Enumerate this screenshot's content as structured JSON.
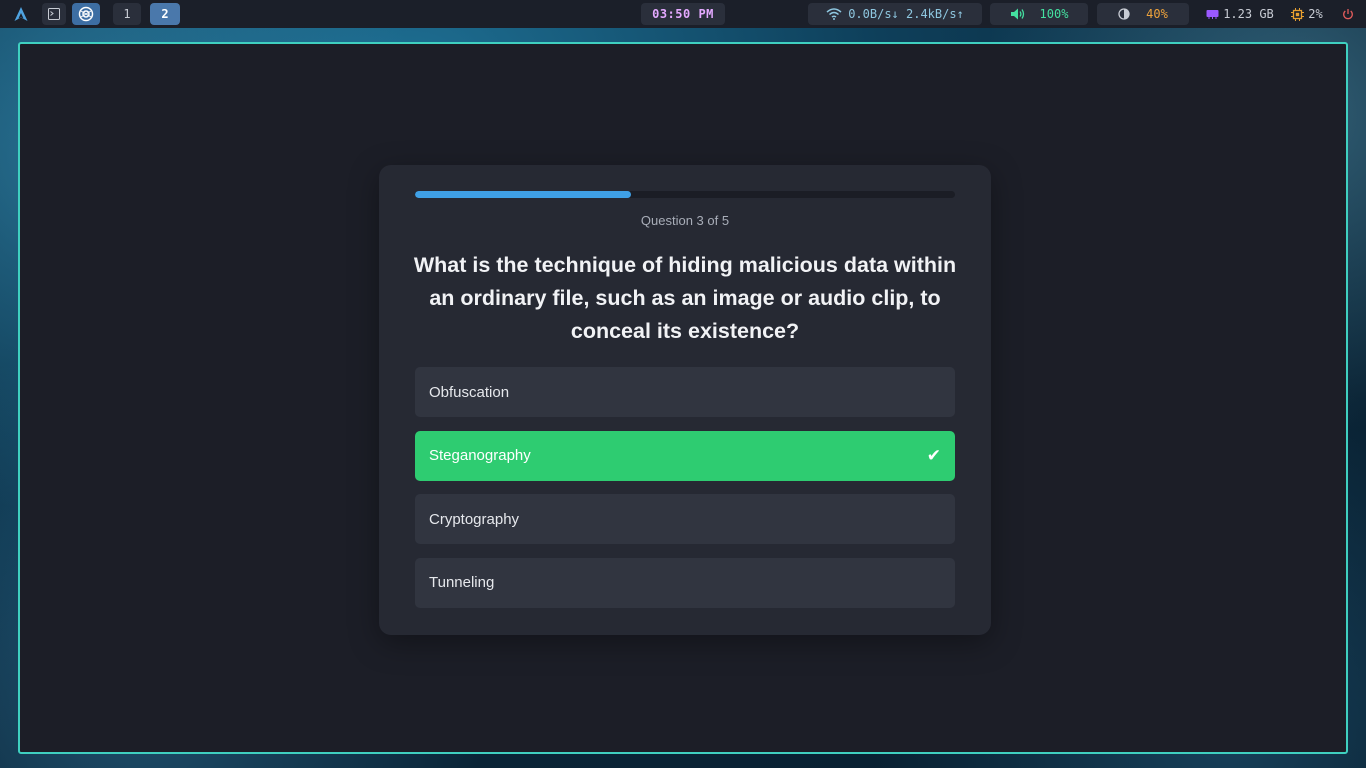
{
  "topbar": {
    "launcher_icon": "arch-linux-icon",
    "terminal_icon": "terminal-icon",
    "app_icon": "browser-app-icon",
    "workspaces": [
      "1",
      "2"
    ],
    "active_workspace": "2",
    "clock": "03:50 PM",
    "network": {
      "icon": "wifi-icon",
      "text": "0.0B/s↓ 2.4kB/s↑"
    },
    "volume": {
      "icon": "speaker-icon",
      "text": "100%"
    },
    "brightness": {
      "icon": "brightness-icon",
      "text": "40%"
    },
    "memory": {
      "icon": "memory-icon",
      "text": "1.23 GB"
    },
    "cpu": {
      "icon": "cpu-icon",
      "text": "2%"
    },
    "power_icon": "power-icon",
    "colors": {
      "clock": "#e3a9ff",
      "network": "#8ec7e0",
      "volume": "#44e0a0",
      "brightness": "#f0a43c",
      "memory_icon": "#9b59ff",
      "cpu_icon": "#e8a030",
      "power": "#e05b5b"
    }
  },
  "quiz": {
    "progress": 0.4,
    "counter": "Question 3 of 5",
    "question": "What is the technique of hiding malicious data within an ordinary file, such as an image or audio clip, to conceal its existence?",
    "options": [
      {
        "label": "Obfuscation",
        "state": "default"
      },
      {
        "label": "Steganography",
        "state": "correct"
      },
      {
        "label": "Cryptography",
        "state": "default"
      },
      {
        "label": "Tunneling",
        "state": "default"
      }
    ],
    "check_mark": "✔",
    "colors": {
      "accent": "#3fa0e6",
      "correct": "#2ecc71",
      "card": "#262933",
      "window_border": "#3fd0c0"
    }
  }
}
